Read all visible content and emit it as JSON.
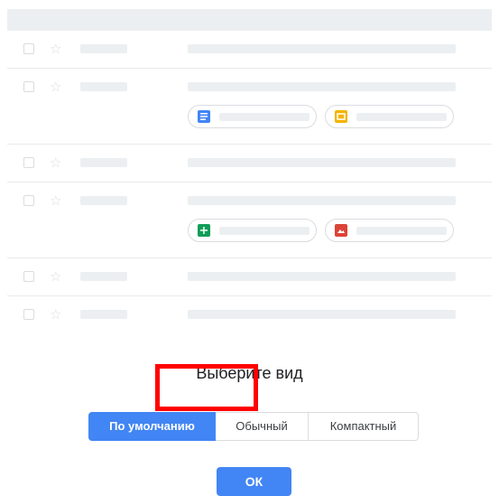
{
  "dialog": {
    "title": "Выберите вид",
    "options": [
      "По умолчанию",
      "Обычный",
      "Компактный"
    ],
    "selected": "По умолчанию",
    "ok_label": "ОК"
  },
  "icons": {
    "star": "star-icon",
    "docs": "docs-icon",
    "slides": "slides-icon",
    "sheets": "sheets-icon",
    "photos": "image-icon"
  },
  "colors": {
    "accent": "#4285f4",
    "highlight": "#ff0000",
    "docs": "#4285f4",
    "slides": "#f4b400",
    "sheets": "#0f9d58",
    "photos": "#db4437"
  }
}
